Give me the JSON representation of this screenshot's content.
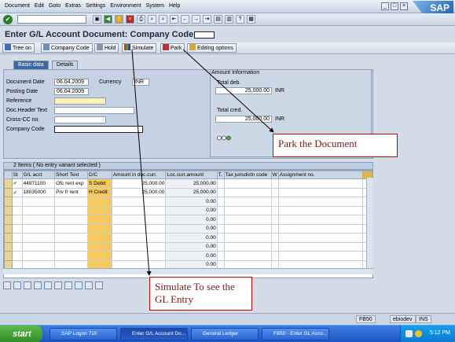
{
  "menu": [
    "Document",
    "Edit",
    "Goto",
    "Extras",
    "Settings",
    "Environment",
    "System",
    "Help"
  ],
  "brand": "SAP",
  "title": "Enter G/L Account Document: Company Code",
  "app_toolbar": {
    "tree_on": "Tree on",
    "company_code": "Company Code",
    "hold": "Hold",
    "simulate": "Simulate",
    "park": "Park",
    "editing_options": "Editing options"
  },
  "tabs": [
    "Basic data",
    "Details"
  ],
  "header": {
    "document_date_label": "Document Date",
    "document_date": "06.04.2009",
    "currency_label": "Currency",
    "currency": "INR",
    "posting_date_label": "Posting Date",
    "posting_date": "06.04.2009",
    "reference_label": "Reference",
    "doc_header_text_label": "Doc.Header Text",
    "cross_cc_label": "Cross-CC no.",
    "company_code_label": "Company Code"
  },
  "amount_info": {
    "title": "Amount Information",
    "total_deb_label": "Total deb.",
    "total_deb": "25,000.00",
    "total_cred_label": "Total cred.",
    "total_cred": "25,000.00",
    "currency": "INR"
  },
  "callouts": {
    "park": "Park the Document",
    "simulate": "Simulate To  see the GL Entry"
  },
  "grid": {
    "title": "2 Items ( No entry variant selected )",
    "columns": [
      "St",
      "G/L acct",
      "Short Text",
      "D/C",
      "Amount in doc.curr.",
      "Loc.curr.amount",
      "T.",
      "Tax jurisdictn code",
      "W",
      "Assignment no."
    ],
    "rows": [
      {
        "status": "✔",
        "gl": "44971100",
        "text": "Ofc rent exp",
        "dc": "S Debit",
        "amt": "25,000.00",
        "loc": "25,000.00"
      },
      {
        "status": "✔",
        "gl": "18035000",
        "text": "Prv fr rent",
        "dc": "H Credit",
        "amt": "25,000.00",
        "loc": "25,000.00"
      }
    ],
    "empty_loc": "0.00"
  },
  "status_bar": {
    "transaction": "FB50",
    "server": "ebiodev",
    "mode": "INS"
  },
  "taskbar": {
    "start": "start",
    "tasks": [
      "SAP Logon 710",
      "Enter G/L Account Do...",
      "General Ledger",
      "FB50 - Enter GL Acco..."
    ],
    "clock": "5:12 PM"
  },
  "colors": {
    "tab_active": "#3e6aa3",
    "required_field": "#fff2b5",
    "callout_border": "#cc0000",
    "taskbar": "#245edb"
  }
}
